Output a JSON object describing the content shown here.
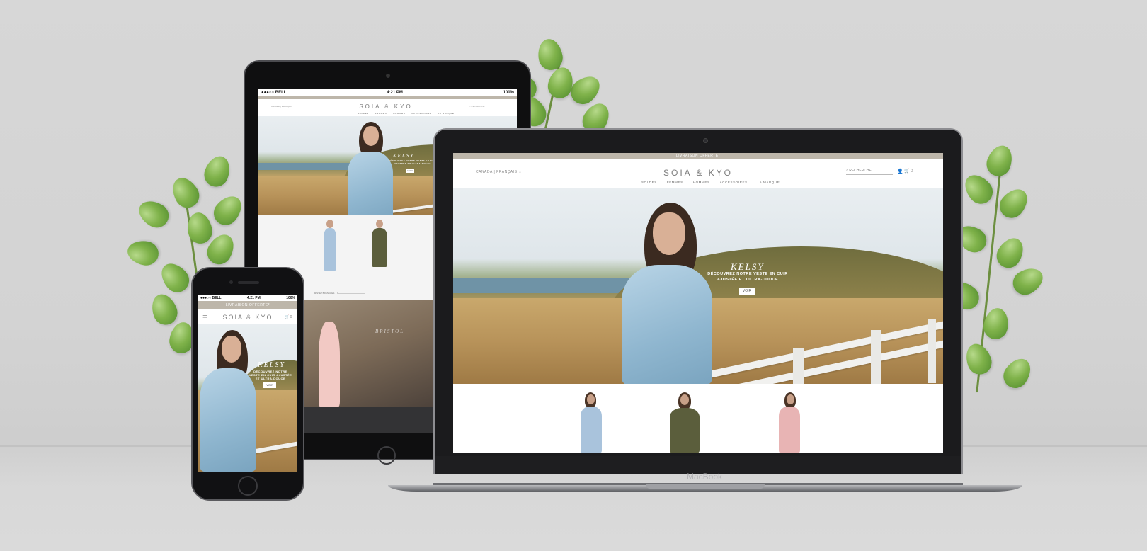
{
  "devices": {
    "laptop": {
      "brand": "MacBook",
      "promo": "LIVRAISON OFFERTE*",
      "locale": "CANADA | FRANÇAIS",
      "logo": "SOIA & KYO",
      "search_placeholder": "RECHERCHE",
      "cart_count": "0",
      "nav": [
        "SOLDES",
        "FEMMES",
        "HOMMES",
        "ACCESSOIRES",
        "LA MARQUE"
      ],
      "hero": {
        "title": "KELSY",
        "subtitle_line1": "DÉCOUVREZ NOTRE VESTE EN CUIR",
        "subtitle_line2": "AJUSTÉE ET ULTRA-DOUCE",
        "button": "VOIR"
      },
      "products": [
        {
          "color": "#a9c3dc"
        },
        {
          "color": "#5b5e3c"
        },
        {
          "color": "#e8b4b4"
        }
      ]
    },
    "tablet": {
      "status_carrier": "BELL",
      "status_time": "4:21 PM",
      "status_battery": "100%",
      "locale": "CANADA | FRANÇAIS",
      "logo": "SOIA & KYO",
      "search_placeholder": "RECHERCHE",
      "nav": [
        "SOLDES",
        "FEMMES",
        "HOMMES",
        "ACCESSOIRES",
        "LA MARQUE"
      ],
      "hero": {
        "title": "KELSY",
        "subtitle": "DÉCOUVREZ NOTRE VESTE EN CUIR AJUSTÉE ET ULTRA-DOUCE",
        "button": "VOIR"
      },
      "products": [
        {
          "color": "#a9c3dc"
        },
        {
          "color": "#5b5e3c"
        },
        {
          "color": "#e8b4b4"
        }
      ],
      "newsletter_label": "RESTEZ BRANCHÉS",
      "second_hero_title": "BRISTOL"
    },
    "phone": {
      "status_carrier": "BELL",
      "status_time": "4:21 PM",
      "status_battery": "100%",
      "promo": "LIVRAISON OFFERTE*",
      "logo": "SOIA & KYO",
      "cart_count": "0",
      "hero": {
        "title": "KELSY",
        "subtitle": "DÉCOUVREZ NOTRE VESTE EN CUIR AJUSTÉE ET ULTRA-DOUCE",
        "button": "VOIR"
      }
    }
  },
  "colors": {
    "promo_bar": "#bdb6aa",
    "logo": "#7b7b7b",
    "jacket_blue": "#8fb6cf"
  }
}
